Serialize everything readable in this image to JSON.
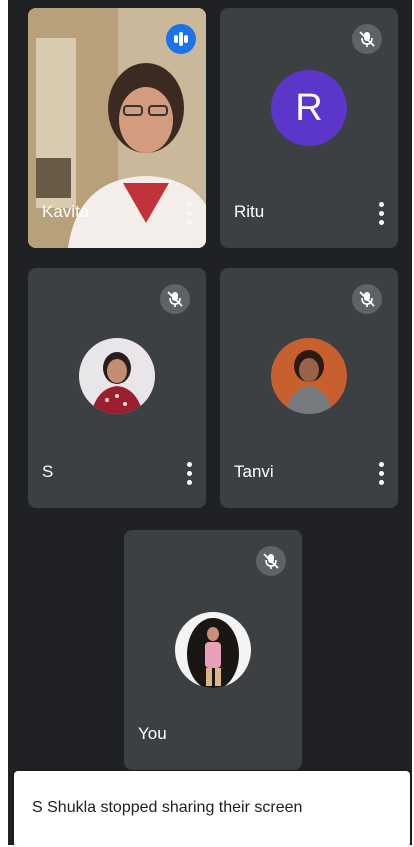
{
  "participants": [
    {
      "name": "Kavita",
      "speaking": true
    },
    {
      "name": "Ritu",
      "avatar_letter": "R",
      "avatar_color": "#5c35c9",
      "muted": true
    },
    {
      "name": "S",
      "muted": true
    },
    {
      "name": "Tanvi",
      "muted": true
    },
    {
      "name": "You",
      "muted": true
    }
  ],
  "toast": {
    "message": "S Shukla stopped sharing their screen"
  },
  "icons": {
    "mute": "mic-off-icon",
    "speaking": "audio-bars-icon",
    "more": "more-vert-icon"
  },
  "colors": {
    "background": "#202124",
    "tile": "#3c4043",
    "mute_badge": "#5f6368",
    "speaking_badge": "#1a73e8"
  }
}
